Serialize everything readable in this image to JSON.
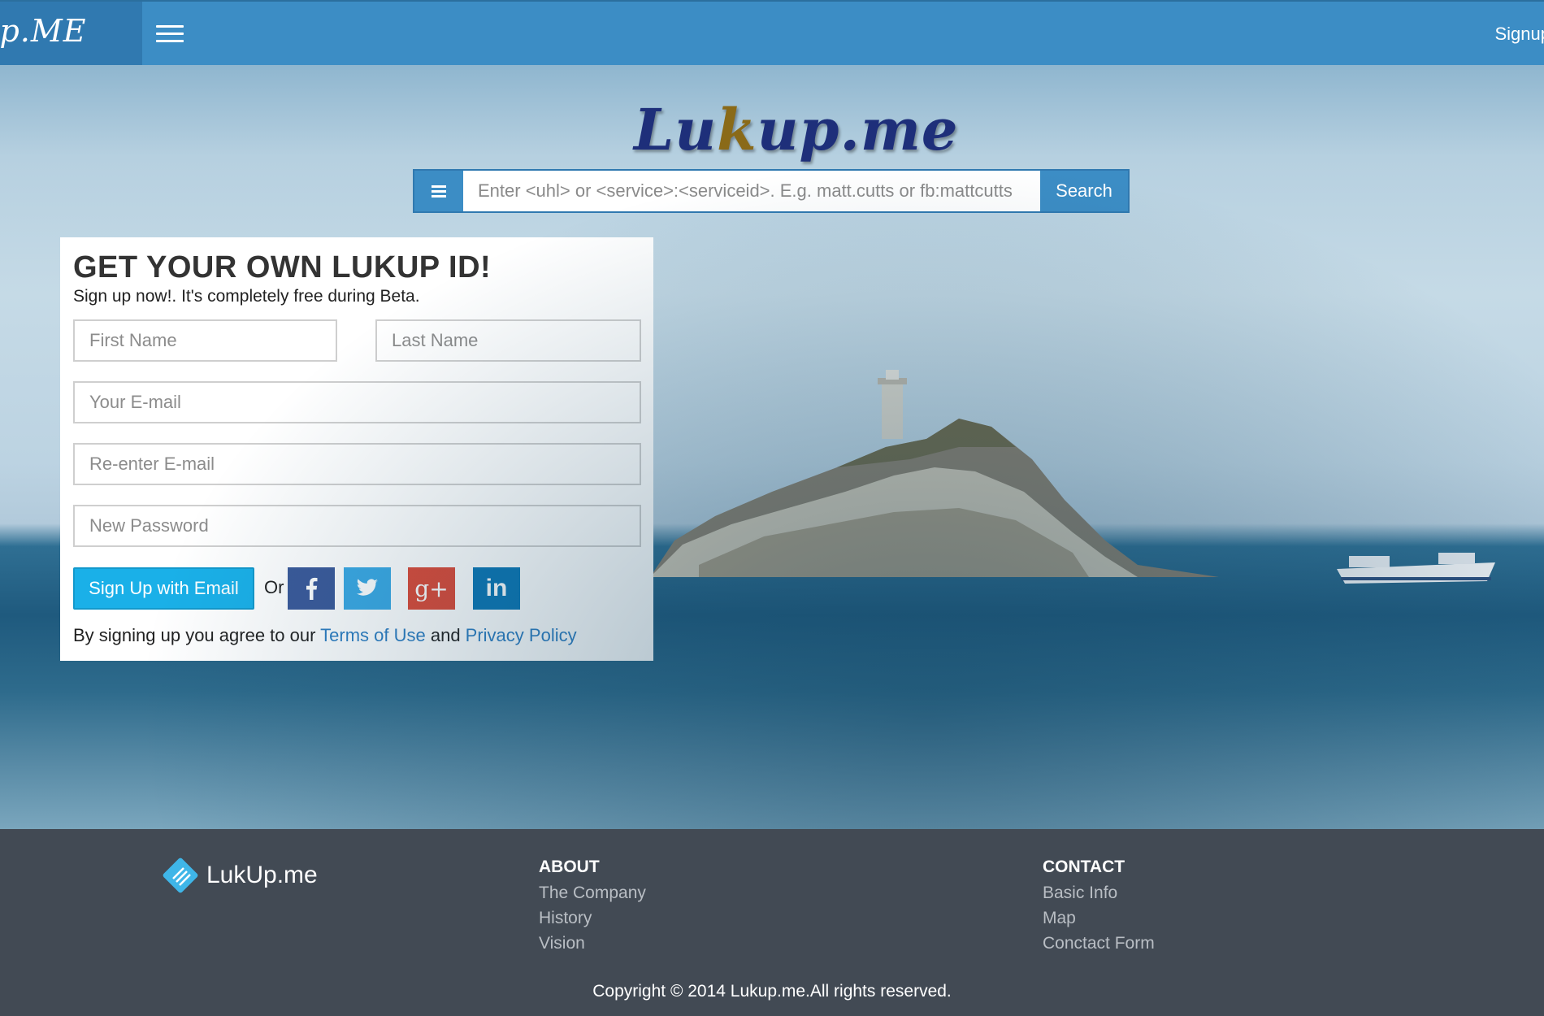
{
  "navbar": {
    "brand": "up.ME",
    "signup_label": "Signup"
  },
  "hero": {
    "logo_text_1": "Lu",
    "logo_text_2": "k",
    "logo_text_3": "up.me",
    "search": {
      "placeholder": "Enter <uhl> or <service>:<serviceid>. E.g. matt.cutts or fb:mattcutts",
      "button_label": "Search"
    }
  },
  "signup_card": {
    "title": "GET YOUR OWN LUKUP ID!",
    "subtitle": "Sign up now!. It's completely free during Beta.",
    "fields": {
      "first_name": "First Name",
      "last_name": "Last Name",
      "email": "Your E-mail",
      "email_confirm": "Re-enter E-mail",
      "password": "New Password"
    },
    "email_button": "Sign Up with Email",
    "or_text": "Or",
    "social": {
      "facebook": "f",
      "google": "g+",
      "linkedin": "in"
    },
    "terms_prefix": "By signing up you agree to our ",
    "terms_link": "Terms of Use",
    "terms_and": " and ",
    "privacy_link": "Privacy Policy"
  },
  "footer": {
    "logo_text": "LukUp.me",
    "about": {
      "heading": "ABOUT",
      "links": [
        "The Company",
        "History",
        "Vision"
      ]
    },
    "contact": {
      "heading": "CONTACT",
      "links": [
        "Basic Info",
        "Map",
        "Conctact Form"
      ]
    },
    "copyright": "Copyright © 2014 Lukup.me.All rights reserved."
  },
  "colors": {
    "navbar": "#3c8dc5",
    "brand_bg": "#3079b0",
    "email_button": "#1ab0e8",
    "facebook": "#3b5a9a",
    "twitter": "#3ba9e4",
    "google": "#dc4a38",
    "linkedin": "#0d77b5",
    "footer": "#424a54",
    "link": "#2e7ec2"
  },
  "icons": {
    "menu": "hamburger-icon",
    "search_menu": "list-icon",
    "facebook": "facebook-icon",
    "twitter": "twitter-icon",
    "google": "google-plus-icon",
    "linkedin": "linkedin-icon",
    "footer_logo": "lukup-logo-icon"
  }
}
